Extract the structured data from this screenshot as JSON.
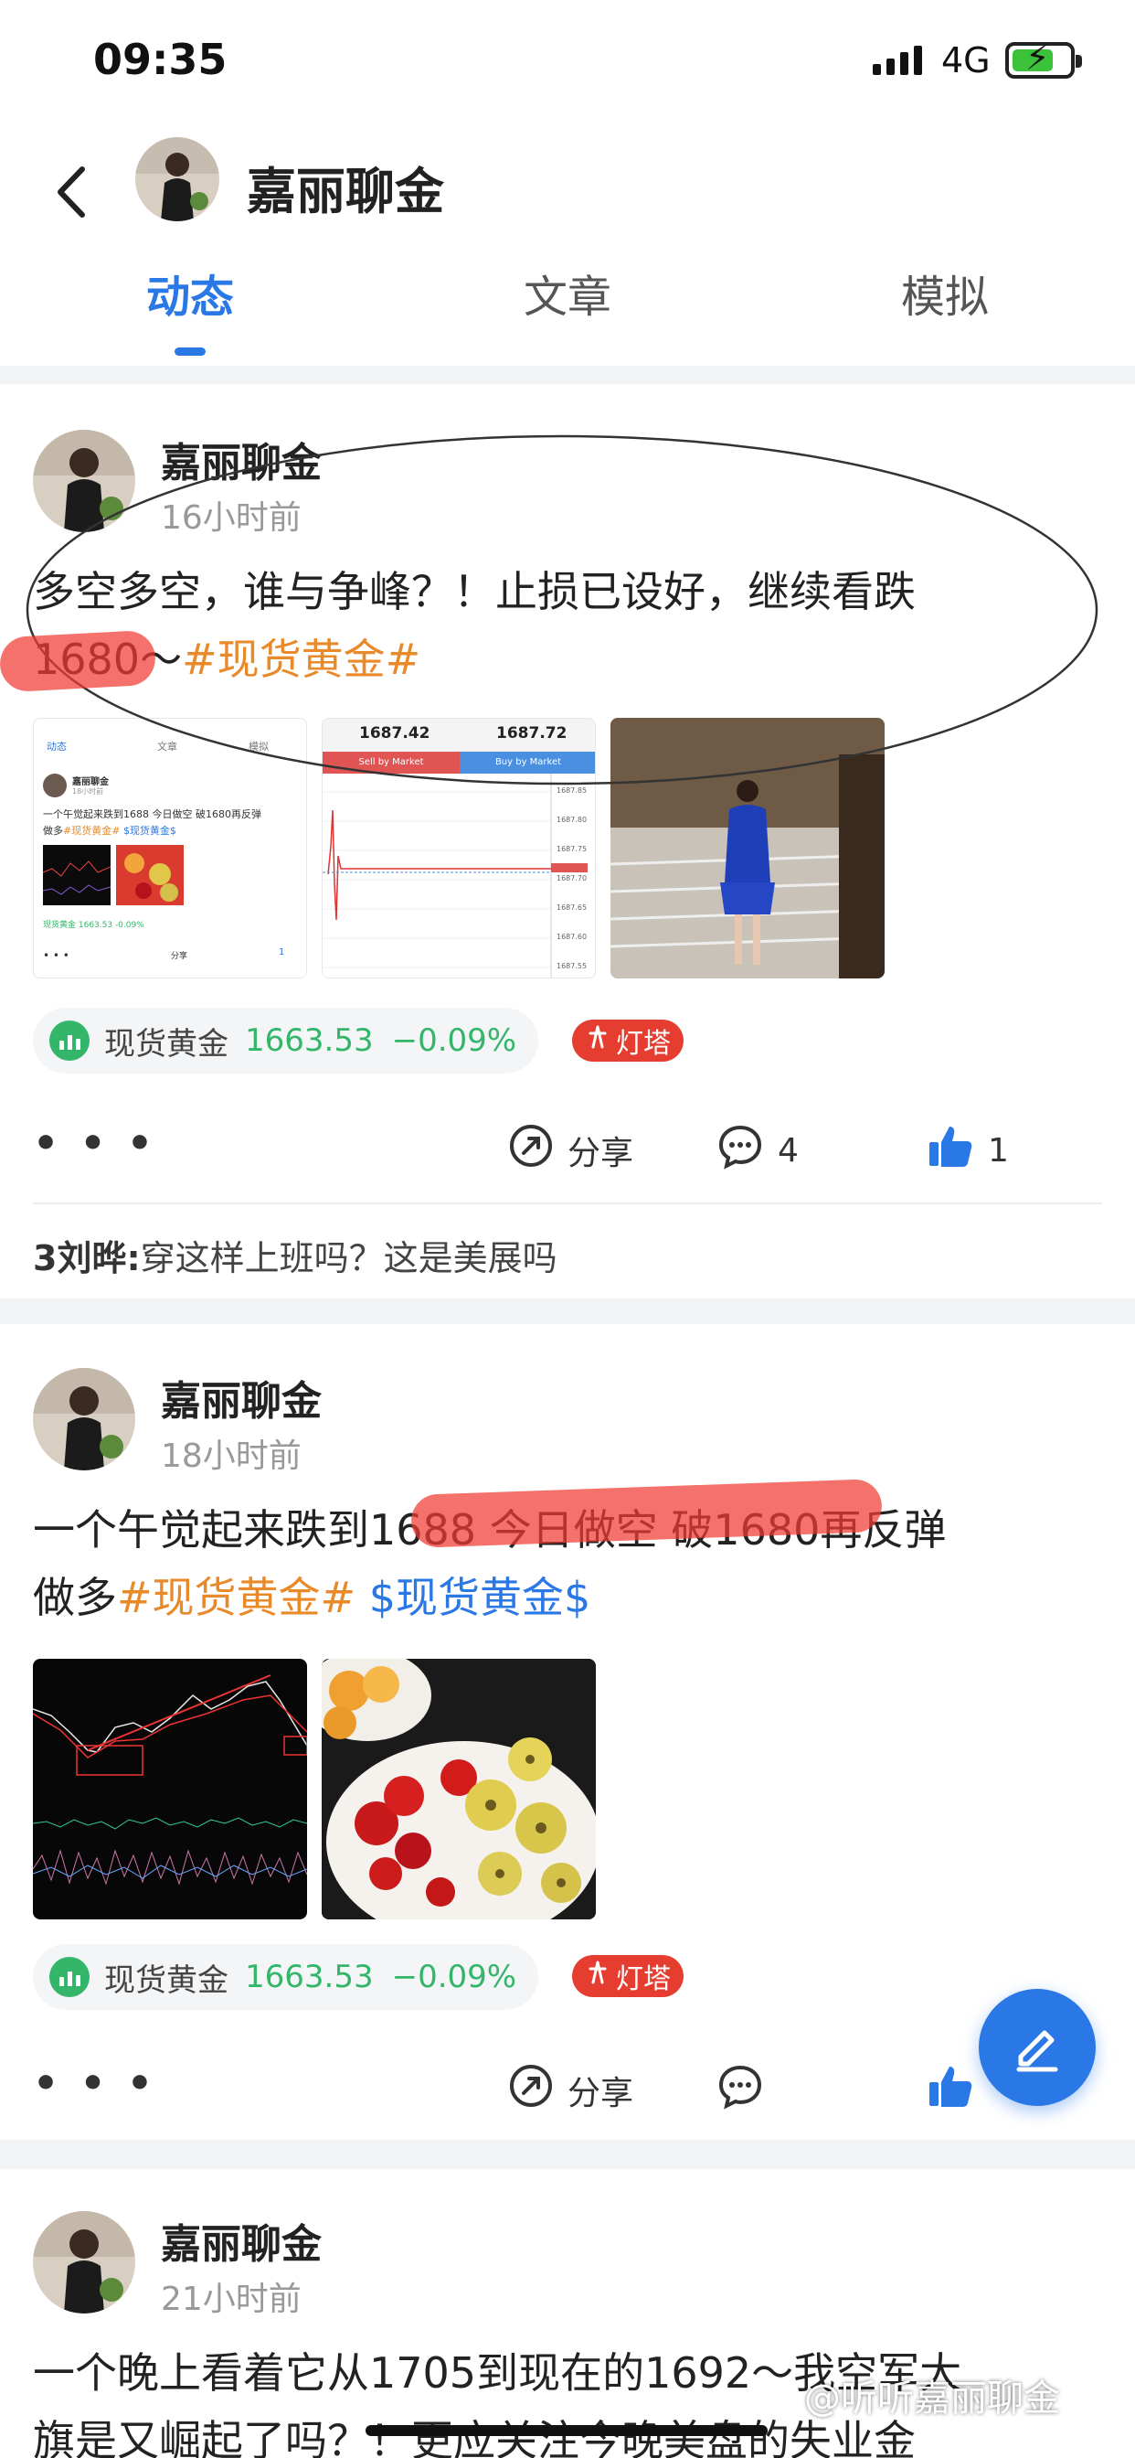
{
  "status_bar": {
    "time": "09:35",
    "network": "4G"
  },
  "header": {
    "title": "嘉丽聊金"
  },
  "tabs": [
    {
      "label": "动态",
      "active": true
    },
    {
      "label": "文章",
      "active": false
    },
    {
      "label": "模拟",
      "active": false
    }
  ],
  "posts": [
    {
      "author": "嘉丽聊金",
      "time": "16小时前",
      "text_line1": "多空多空，谁与争峰？！止损已设好，继续看跌",
      "text_line2_main": "1680～",
      "text_line2_tag": "#现货黄金#",
      "thumb1": {
        "tabs": [
          "动态",
          "文章",
          "模拟"
        ],
        "author": "嘉丽聊金",
        "time": "18小时前",
        "text": "一个午觉起来跌到1688 今日做空 破1680再反弹",
        "text2_pre": "做多",
        "text2_tag": "#现货黄金#",
        "text2_stock": "$现货黄金$",
        "chip": "现货黄金 1663.53 -0.09%",
        "share": "分享",
        "like_count": "1"
      },
      "thumb2": {
        "sell_price": "1687.42",
        "buy_price": "1687.72",
        "sell_label": "Sell by Market",
        "buy_label": "Buy by Market",
        "axis": [
          "1687.85",
          "1687.80",
          "1687.75",
          "1687.70",
          "1687.65",
          "1687.60",
          "1687.55"
        ]
      },
      "quote": {
        "name": "现货黄金",
        "price": "1663.53",
        "change": "−0.09%"
      },
      "lamp_label": "灯塔",
      "share_label": "分享",
      "comment_count": "4",
      "like_count": "1",
      "comment_preview_user": "3刘晔:",
      "comment_preview_text": "穿这样上班吗？这是美展吗"
    },
    {
      "author": "嘉丽聊金",
      "time": "18小时前",
      "text_line1": "一个午觉起来跌到1688 今日做空 破1680再反弹",
      "text_line2_pre": "做多",
      "text_line2_tag": "#现货黄金#",
      "text_line2_stock": "$现货黄金$",
      "quote": {
        "name": "现货黄金",
        "price": "1663.53",
        "change": "−0.09%"
      },
      "lamp_label": "灯塔",
      "share_label": "分享"
    },
    {
      "author": "嘉丽聊金",
      "time": "21小时前",
      "text_line1": "一个晚上看着它从1705到现在的1692～我空军大",
      "text_line2": "旗是又崛起了吗？！更应关注今晚美盘的失业金"
    }
  ],
  "watermark": "@听听嘉丽聊金",
  "colors": {
    "accent": "#2a77e6",
    "tag": "#e8892a",
    "down": "#34b66a",
    "lamp": "#e53d2f"
  },
  "icons": [
    "back-arrow-icon",
    "share-icon",
    "comment-icon",
    "thumbs-up-icon",
    "edit-pencil-icon",
    "more-dots-icon",
    "quote-chart-icon",
    "lamp-tower-icon"
  ]
}
